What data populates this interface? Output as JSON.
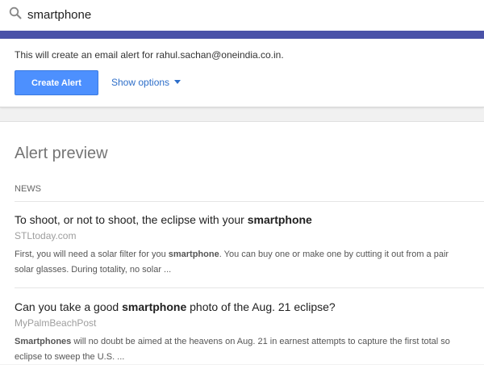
{
  "search": {
    "query": "smartphone",
    "icon": "search-icon"
  },
  "colors": {
    "accent_bar": "#4a52a8",
    "primary_button": "#4d90fe",
    "link": "#2d6ec9"
  },
  "alert": {
    "info_text": "This will create an email alert for rahul.sachan@oneindia.co.in.",
    "create_button_label": "Create Alert",
    "show_options_label": "Show options",
    "show_options_icon": "chevron-down-icon"
  },
  "preview": {
    "title": "Alert preview",
    "section_label": "NEWS",
    "articles": [
      {
        "title_pre": "To shoot, or not to shoot, the eclipse with your ",
        "title_bold": "smartphone",
        "title_post": "",
        "source": "STLtoday.com",
        "snippet_line1_pre": "First, you will need a solar filter for you ",
        "snippet_line1_bold": "smartphone",
        "snippet_line1_post": ". You can buy one or make one by cutting it out from a pair",
        "snippet_line2": "solar glasses. During totality, no solar ..."
      },
      {
        "title_pre": "Can you take a good ",
        "title_bold": "smartphone",
        "title_post": " photo of the Aug. 21 eclipse?",
        "source": "MyPalmBeachPost",
        "snippet_line1_pre": "",
        "snippet_line1_bold": "Smartphones",
        "snippet_line1_post": " will no doubt be aimed at the heavens on Aug. 21 in earnest attempts to capture the first total so",
        "snippet_line2": "eclipse to sweep the U.S. ..."
      }
    ]
  }
}
